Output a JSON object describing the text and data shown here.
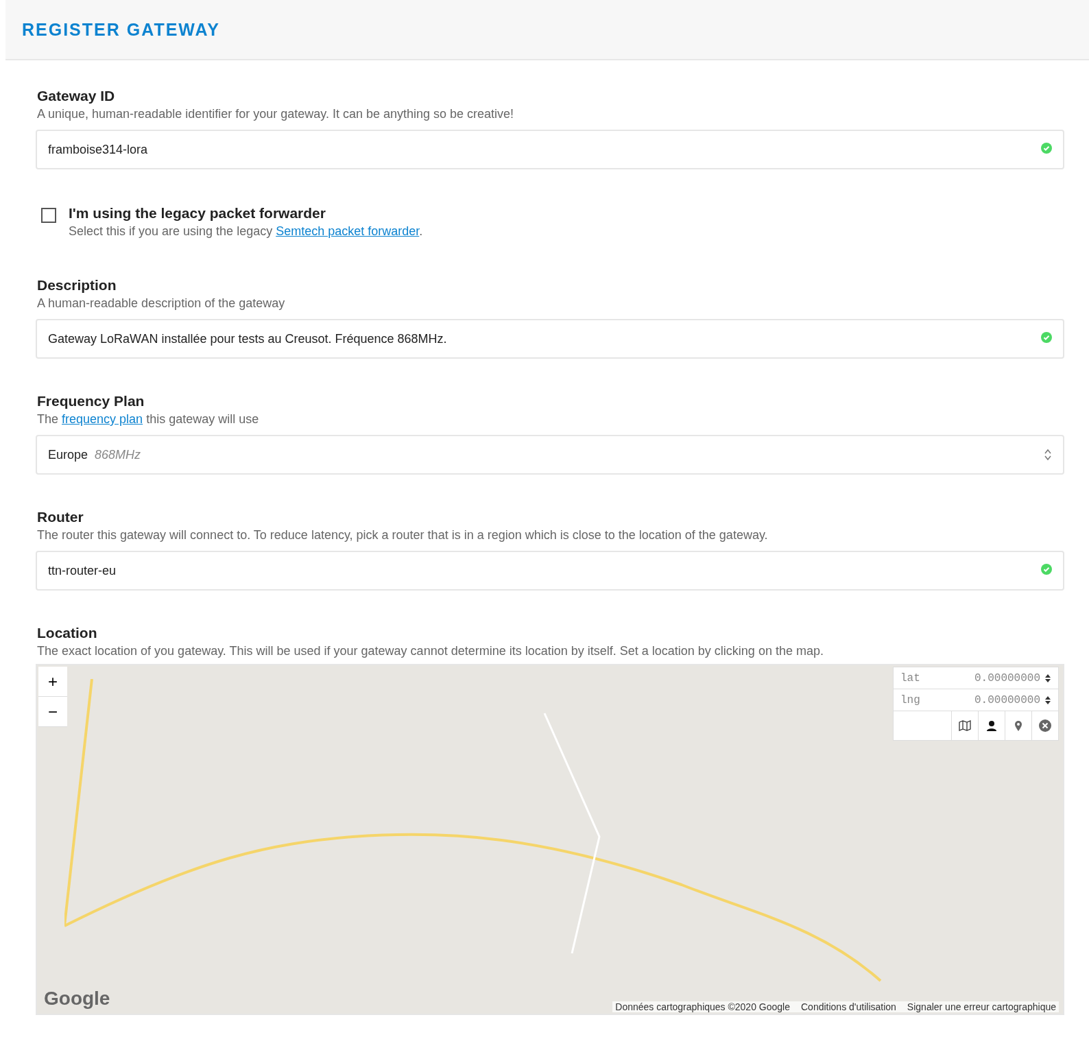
{
  "header": {
    "title": "REGISTER GATEWAY"
  },
  "gateway_id": {
    "label": "Gateway ID",
    "help": "A unique, human-readable identifier for your gateway. It can be anything so be creative!",
    "value": "framboise314-lora",
    "valid": true
  },
  "legacy": {
    "label": "I'm using the legacy packet forwarder",
    "checked": false,
    "help_before": "Select this if you are using the legacy ",
    "link": "Semtech packet forwarder",
    "help_after": "."
  },
  "description": {
    "label": "Description",
    "help": "A human-readable description of the gateway",
    "value": "Gateway LoRaWAN installée pour tests au Creusot. Fréquence 868MHz.",
    "valid": true
  },
  "frequency_plan": {
    "label": "Frequency Plan",
    "help_before": "The ",
    "link": "frequency plan",
    "help_after": " this gateway will use",
    "value": "Europe",
    "detail": "868MHz"
  },
  "router": {
    "label": "Router",
    "help": "The router this gateway will connect to. To reduce latency, pick a router that is in a region which is close to the location of the gateway.",
    "value": "ttn-router-eu",
    "valid": true
  },
  "location": {
    "label": "Location",
    "help": "The exact location of you gateway. This will be used if your gateway cannot determine its location by itself. Set a location by clicking on the map.",
    "zoom_in": "+",
    "zoom_out": "−",
    "coords": [
      {
        "label": "lat",
        "placeholder": "0.00000000"
      },
      {
        "label": "lng",
        "placeholder": "0.00000000"
      }
    ],
    "logo": "Google",
    "attribution": [
      "Données cartographiques ©2020 Google",
      "Conditions d'utilisation",
      "Signaler une erreur cartographique"
    ]
  }
}
